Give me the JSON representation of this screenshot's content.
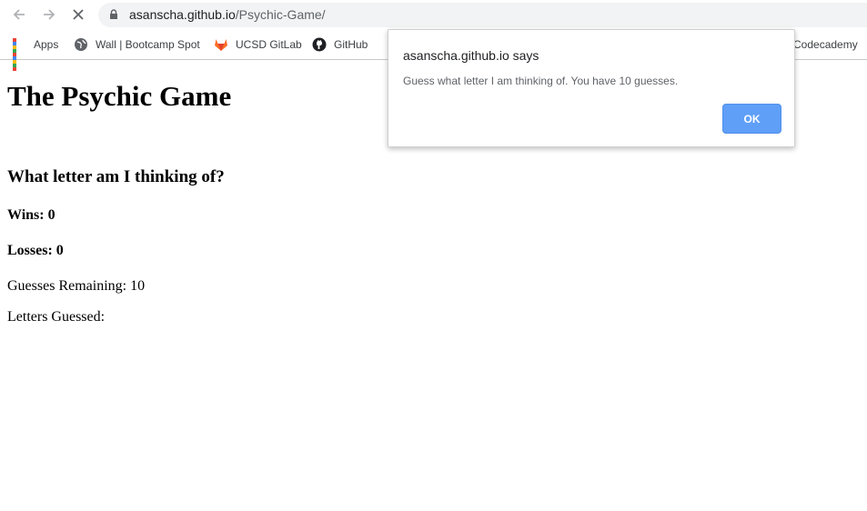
{
  "browser": {
    "url_host": "asanscha.github.io",
    "url_path": "/Psychic-Game/",
    "bookmarks": [
      {
        "label": "Apps",
        "icon": "apps-grid-icon"
      },
      {
        "label": "Wall | Bootcamp Spot",
        "icon": "globe-icon"
      },
      {
        "label": "UCSD GitLab",
        "icon": "gitlab-icon"
      },
      {
        "label": "GitHub",
        "icon": "github-icon"
      },
      {
        "label": "Codecademy",
        "icon": "codecademy-icon"
      }
    ]
  },
  "page": {
    "title": "The Psychic Game",
    "question": "What letter am I thinking of?",
    "wins_label": "Wins: 0",
    "losses_label": "Losses: 0",
    "guesses_label": "Guesses Remaining: 10",
    "letters_label": "Letters Guessed:"
  },
  "dialog": {
    "title": "asanscha.github.io says",
    "message": "Guess what letter I am thinking of. You have 10 guesses.",
    "ok_label": "OK"
  },
  "colors": {
    "ok_button": "#5f9ff7",
    "omnibox": "#f1f3f4"
  }
}
